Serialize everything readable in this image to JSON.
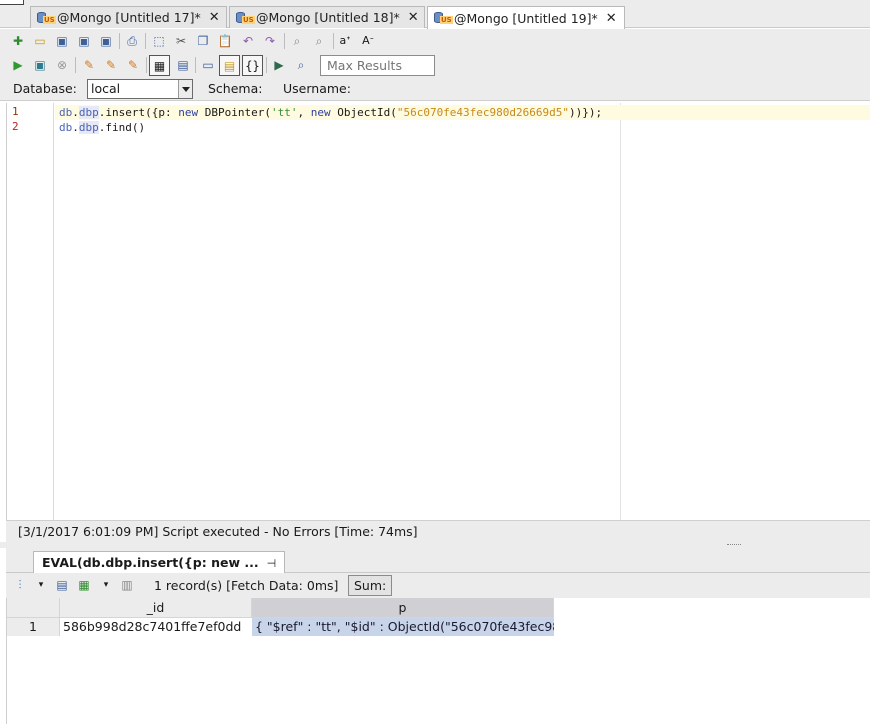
{
  "tabs": [
    {
      "label": "@Mongo [Untitled 17]*",
      "close": "✕",
      "active": false
    },
    {
      "label": "@Mongo [Untitled 18]*",
      "close": "✕",
      "active": false
    },
    {
      "label": "@Mongo [Untitled 19]*",
      "close": "✕",
      "active": true
    }
  ],
  "toolbar": {
    "max_results_placeholder": "Max Results",
    "icons_row1": [
      "new-file-icon",
      "open-folder-icon",
      "save-icon",
      "save-as-icon",
      "save-all-icon",
      "print-icon",
      "select-icon",
      "cut-icon",
      "copy-icon",
      "paste-icon",
      "undo-icon",
      "redo-icon",
      "find-icon",
      "find-replace-icon",
      "font-increase-icon",
      "font-decrease-icon"
    ],
    "icons_row2": [
      "run-icon",
      "run-script-icon",
      "cancel-icon",
      "format-icon",
      "comment-icon",
      "uncomment-icon",
      "grid-output-icon",
      "form-output-icon",
      "text-output-icon",
      "json-output-icon",
      "explain-icon",
      "history-icon",
      "toggle-icon"
    ]
  },
  "connection": {
    "database_label": "Database:",
    "database_value": "local",
    "schema_label": "Schema:",
    "username_label": "Username:"
  },
  "editor": {
    "line_numbers": [
      "1",
      "2"
    ],
    "line1": {
      "db": "db",
      "dot1": ".",
      "col": "dbp",
      "call": ".insert({p: ",
      "new1": "new",
      "ctor": " DBPointer(",
      "str": "'tt'",
      "comma": ", ",
      "new2": "new",
      "oid": " ObjectId(",
      "hex": "\"56c070fe43fec980d26669d5\"",
      "end": "))});"
    },
    "line2": {
      "db": "db",
      "dot1": ".",
      "col": "dbp",
      "call": ".find()"
    }
  },
  "status": {
    "text": "[3/1/2017 6:01:09 PM] Script executed - No Errors [Time: 74ms]"
  },
  "result": {
    "tab_label": "EVAL(db.dbp.insert({p: new ...",
    "tab_pin": "⊣",
    "record_count": "1 record(s) [Fetch Data: 0ms]",
    "sum_label": "Sum:",
    "columns": [
      "_id",
      "p"
    ],
    "rows": [
      {
        "num": "1",
        "id": "586b998d28c7401ffe7ef0dd",
        "p": "{ \"$ref\" : \"tt\", \"$id\" : ObjectId(\"56c070fe43fec98"
      }
    ]
  },
  "colors": {
    "accent_keyword": "#4a64b8",
    "string_hex": "#c8891a",
    "selected_cell": "#c8d4ea"
  }
}
